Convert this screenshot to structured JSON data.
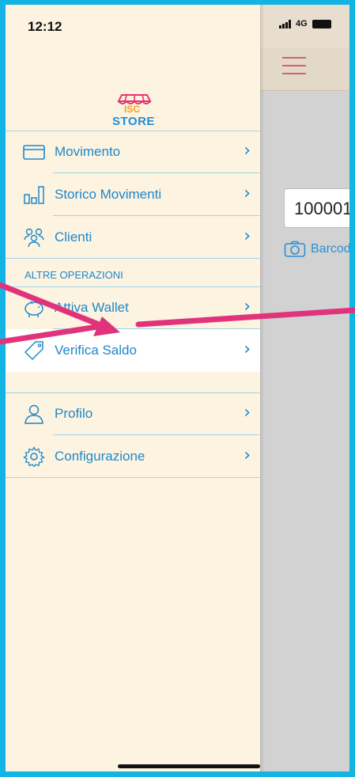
{
  "status_bar": {
    "time": "12:12",
    "network": "4G"
  },
  "logo": {
    "line1": "ISC",
    "line2": "STORE"
  },
  "menu": {
    "items": [
      {
        "label": "Movimento",
        "icon": "card-icon"
      },
      {
        "label": "Storico Movimenti",
        "icon": "bar-chart-icon"
      },
      {
        "label": "Clienti",
        "icon": "users-icon"
      }
    ],
    "section_header": "ALTRE OPERAZIONI",
    "other_items": [
      {
        "label": "Attiva Wallet",
        "icon": "piggy-bank-icon"
      },
      {
        "label": "Verifica Saldo",
        "icon": "tag-icon",
        "selected": true
      }
    ],
    "settings_items": [
      {
        "label": "Profilo",
        "icon": "person-icon"
      },
      {
        "label": "Configurazione",
        "icon": "gear-icon"
      }
    ],
    "chevron": "›"
  },
  "background": {
    "code_value": "100001",
    "barcode_label": "Barcod"
  },
  "colors": {
    "frame": "#11b4e3",
    "drawer_bg": "#fdf3e1",
    "menu_text": "#1e88c9",
    "arrow": "#e0337c",
    "hamburger": "#d45d7a"
  }
}
